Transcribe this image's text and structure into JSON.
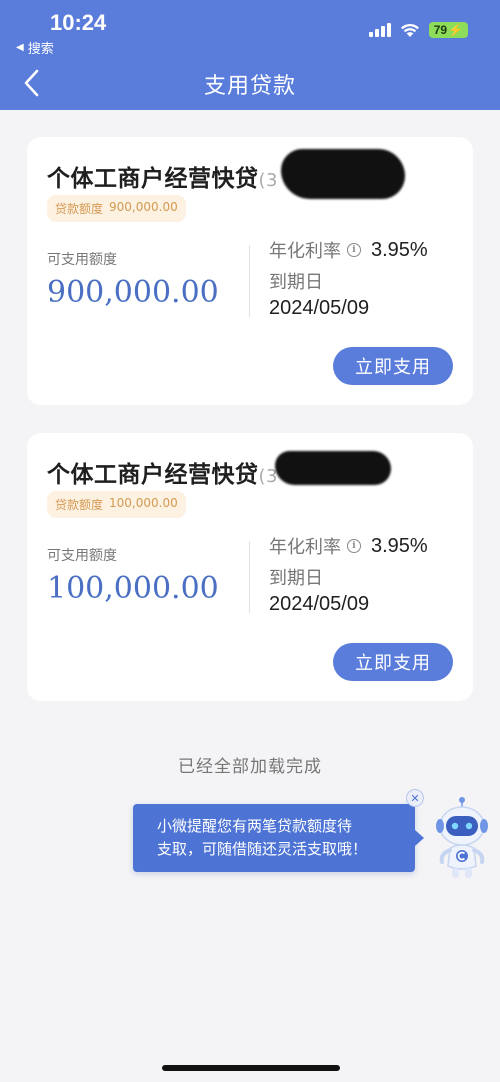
{
  "status": {
    "time": "10:24",
    "back_app": "搜索",
    "battery": "79"
  },
  "header": {
    "title": "支用贷款"
  },
  "loans": [
    {
      "name": "个体工商户经营快贷",
      "name_suffix": "(3",
      "quota_label": "贷款额度",
      "quota_value": "900,000.00",
      "available_label": "可支用额度",
      "available_amount": "900,000.00",
      "rate_label": "年化利率",
      "rate_value": "3.95%",
      "due_label": "到期日",
      "due_value": "2024/05/09",
      "button": "立即支用"
    },
    {
      "name": "个体工商户经营快贷",
      "name_suffix": "(3",
      "quota_label": "贷款额度",
      "quota_value": "100,000.00",
      "available_label": "可支用额度",
      "available_amount": "100,000.00",
      "rate_label": "年化利率",
      "rate_value": "3.95%",
      "due_label": "到期日",
      "due_value": "2024/05/09",
      "button": "立即支用"
    }
  ],
  "footer": {
    "loaded_text": "已经全部加载完成"
  },
  "tip": {
    "line1": "小微提醒您有两笔贷款额度待",
    "line2": "支取，可随借随还灵活支取哦！"
  },
  "colors": {
    "brand": "#5a7ddc",
    "amount": "#4a6fc3",
    "badge_text": "#d49a52",
    "badge_bg": "#fdf1e2"
  },
  "icons": [
    "back-arrow-icon",
    "info-icon",
    "close-icon",
    "robot-assistant-icon",
    "signal-icon",
    "wifi-icon",
    "battery-icon"
  ]
}
